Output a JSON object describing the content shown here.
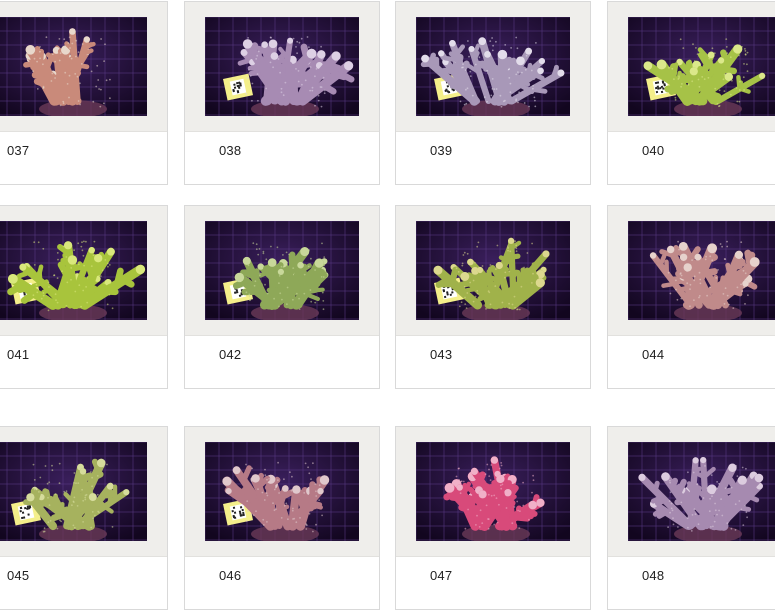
{
  "gallery": {
    "items": [
      {
        "label": "037",
        "coral": "#c98a7a",
        "tips": "#e8d8cc"
      },
      {
        "label": "038",
        "coral": "#a78bb3",
        "tips": "#ddd0e4",
        "tag": true
      },
      {
        "label": "039",
        "coral": "#a898b8",
        "tips": "#e2dcea",
        "tag": true
      },
      {
        "label": "040",
        "coral": "#a6c247",
        "tips": "#dbe88a",
        "tag": true
      },
      {
        "label": "041",
        "coral": "#a8c43c",
        "tips": "#d9e87c",
        "tag": true
      },
      {
        "label": "042",
        "coral": "#8ea858",
        "tips": "#c8d89a",
        "tag": true
      },
      {
        "label": "043",
        "coral": "#a0b24a",
        "tips": "#dcd88e",
        "tag": true
      },
      {
        "label": "044",
        "coral": "#c08a8a",
        "tips": "#e6d2cc"
      },
      {
        "label": "045",
        "coral": "#a6b25e",
        "tips": "#d6dc9c",
        "tag": true
      },
      {
        "label": "046",
        "coral": "#b67a86",
        "tips": "#e0c8cc",
        "tag": true
      },
      {
        "label": "047",
        "coral": "#d84a7a",
        "tips": "#f0b0c8",
        "tag": false
      },
      {
        "label": "048",
        "coral": "#a68ab0",
        "tips": "#dcccdf"
      }
    ]
  }
}
